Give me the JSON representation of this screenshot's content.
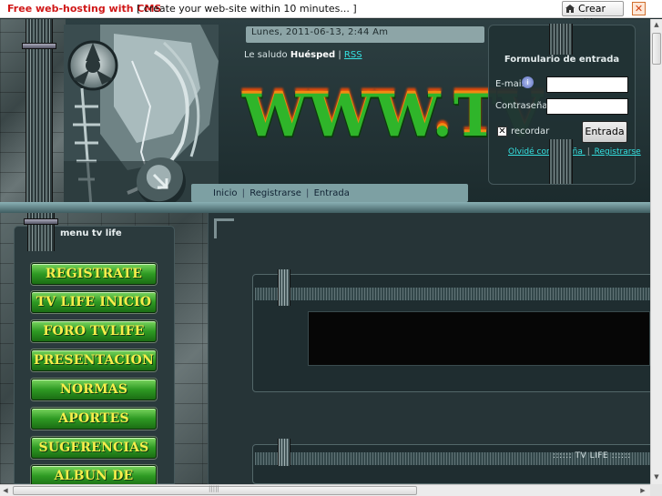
{
  "topbar": {
    "promo": "Free web-hosting with CMS",
    "slogan": "[ create your web-site within 10 minutes... ]",
    "create_site": "Crear sitio",
    "close": "✕"
  },
  "header": {
    "date": "Lunes, 2011-06-13, 2:44 Am",
    "greeting_prefix": "Le saludo",
    "user": "Huésped",
    "greeting_sep": "|",
    "rss": "RSS",
    "logo_text": "WWW.TV",
    "nav": [
      "Inicio",
      "Registrarse",
      "Entrada"
    ],
    "nav_sep": "|"
  },
  "login": {
    "title": "Formulario de entrada",
    "email_label": "E-mail:",
    "email_info": "i",
    "email_value": "",
    "password_label": "Contraseña:",
    "password_value": "",
    "remember_label": "recordar",
    "remember_checked": "✕",
    "submit": "Entrada",
    "forgot": "Olvidé contraseña",
    "links_sep": "|",
    "register": "Registrarse"
  },
  "menu": {
    "title": "menu tv life",
    "items": [
      "REGISTRATE",
      "TV LIFE INICIO",
      "FORO TVLIFE",
      "PRESENTACION",
      "NORMAS",
      "APORTES",
      "SUGERENCIAS",
      "ALBUN DE FOTOS"
    ]
  },
  "content": {
    "box2_title": ":::::: TV LIFE ::::::"
  },
  "scroll": {
    "up": "▲",
    "down": "▼",
    "left": "◀",
    "right": "▶",
    "grip": "|||||"
  },
  "colors": {
    "accent_link": "#35e2e2",
    "menu_button_green": "#2e9a23",
    "menu_text_yellow": "#f8ee4b",
    "promo_red": "#d01818"
  }
}
